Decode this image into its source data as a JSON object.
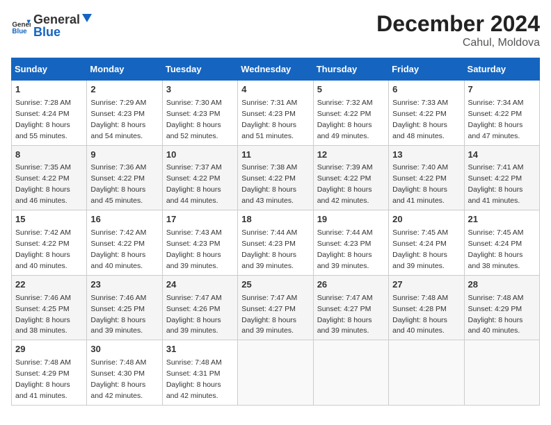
{
  "header": {
    "logo_general": "General",
    "logo_blue": "Blue",
    "title": "December 2024",
    "subtitle": "Cahul, Moldova"
  },
  "calendar": {
    "headers": [
      "Sunday",
      "Monday",
      "Tuesday",
      "Wednesday",
      "Thursday",
      "Friday",
      "Saturday"
    ],
    "weeks": [
      [
        {
          "day": "1",
          "sunrise": "7:28 AM",
          "sunset": "4:24 PM",
          "daylight": "8 hours and 55 minutes."
        },
        {
          "day": "2",
          "sunrise": "7:29 AM",
          "sunset": "4:23 PM",
          "daylight": "8 hours and 54 minutes."
        },
        {
          "day": "3",
          "sunrise": "7:30 AM",
          "sunset": "4:23 PM",
          "daylight": "8 hours and 52 minutes."
        },
        {
          "day": "4",
          "sunrise": "7:31 AM",
          "sunset": "4:23 PM",
          "daylight": "8 hours and 51 minutes."
        },
        {
          "day": "5",
          "sunrise": "7:32 AM",
          "sunset": "4:22 PM",
          "daylight": "8 hours and 49 minutes."
        },
        {
          "day": "6",
          "sunrise": "7:33 AM",
          "sunset": "4:22 PM",
          "daylight": "8 hours and 48 minutes."
        },
        {
          "day": "7",
          "sunrise": "7:34 AM",
          "sunset": "4:22 PM",
          "daylight": "8 hours and 47 minutes."
        }
      ],
      [
        {
          "day": "8",
          "sunrise": "7:35 AM",
          "sunset": "4:22 PM",
          "daylight": "8 hours and 46 minutes."
        },
        {
          "day": "9",
          "sunrise": "7:36 AM",
          "sunset": "4:22 PM",
          "daylight": "8 hours and 45 minutes."
        },
        {
          "day": "10",
          "sunrise": "7:37 AM",
          "sunset": "4:22 PM",
          "daylight": "8 hours and 44 minutes."
        },
        {
          "day": "11",
          "sunrise": "7:38 AM",
          "sunset": "4:22 PM",
          "daylight": "8 hours and 43 minutes."
        },
        {
          "day": "12",
          "sunrise": "7:39 AM",
          "sunset": "4:22 PM",
          "daylight": "8 hours and 42 minutes."
        },
        {
          "day": "13",
          "sunrise": "7:40 AM",
          "sunset": "4:22 PM",
          "daylight": "8 hours and 41 minutes."
        },
        {
          "day": "14",
          "sunrise": "7:41 AM",
          "sunset": "4:22 PM",
          "daylight": "8 hours and 41 minutes."
        }
      ],
      [
        {
          "day": "15",
          "sunrise": "7:42 AM",
          "sunset": "4:22 PM",
          "daylight": "8 hours and 40 minutes."
        },
        {
          "day": "16",
          "sunrise": "7:42 AM",
          "sunset": "4:22 PM",
          "daylight": "8 hours and 40 minutes."
        },
        {
          "day": "17",
          "sunrise": "7:43 AM",
          "sunset": "4:23 PM",
          "daylight": "8 hours and 39 minutes."
        },
        {
          "day": "18",
          "sunrise": "7:44 AM",
          "sunset": "4:23 PM",
          "daylight": "8 hours and 39 minutes."
        },
        {
          "day": "19",
          "sunrise": "7:44 AM",
          "sunset": "4:23 PM",
          "daylight": "8 hours and 39 minutes."
        },
        {
          "day": "20",
          "sunrise": "7:45 AM",
          "sunset": "4:24 PM",
          "daylight": "8 hours and 39 minutes."
        },
        {
          "day": "21",
          "sunrise": "7:45 AM",
          "sunset": "4:24 PM",
          "daylight": "8 hours and 38 minutes."
        }
      ],
      [
        {
          "day": "22",
          "sunrise": "7:46 AM",
          "sunset": "4:25 PM",
          "daylight": "8 hours and 38 minutes."
        },
        {
          "day": "23",
          "sunrise": "7:46 AM",
          "sunset": "4:25 PM",
          "daylight": "8 hours and 39 minutes."
        },
        {
          "day": "24",
          "sunrise": "7:47 AM",
          "sunset": "4:26 PM",
          "daylight": "8 hours and 39 minutes."
        },
        {
          "day": "25",
          "sunrise": "7:47 AM",
          "sunset": "4:27 PM",
          "daylight": "8 hours and 39 minutes."
        },
        {
          "day": "26",
          "sunrise": "7:47 AM",
          "sunset": "4:27 PM",
          "daylight": "8 hours and 39 minutes."
        },
        {
          "day": "27",
          "sunrise": "7:48 AM",
          "sunset": "4:28 PM",
          "daylight": "8 hours and 40 minutes."
        },
        {
          "day": "28",
          "sunrise": "7:48 AM",
          "sunset": "4:29 PM",
          "daylight": "8 hours and 40 minutes."
        }
      ],
      [
        {
          "day": "29",
          "sunrise": "7:48 AM",
          "sunset": "4:29 PM",
          "daylight": "8 hours and 41 minutes."
        },
        {
          "day": "30",
          "sunrise": "7:48 AM",
          "sunset": "4:30 PM",
          "daylight": "8 hours and 42 minutes."
        },
        {
          "day": "31",
          "sunrise": "7:48 AM",
          "sunset": "4:31 PM",
          "daylight": "8 hours and 42 minutes."
        },
        null,
        null,
        null,
        null
      ]
    ]
  }
}
